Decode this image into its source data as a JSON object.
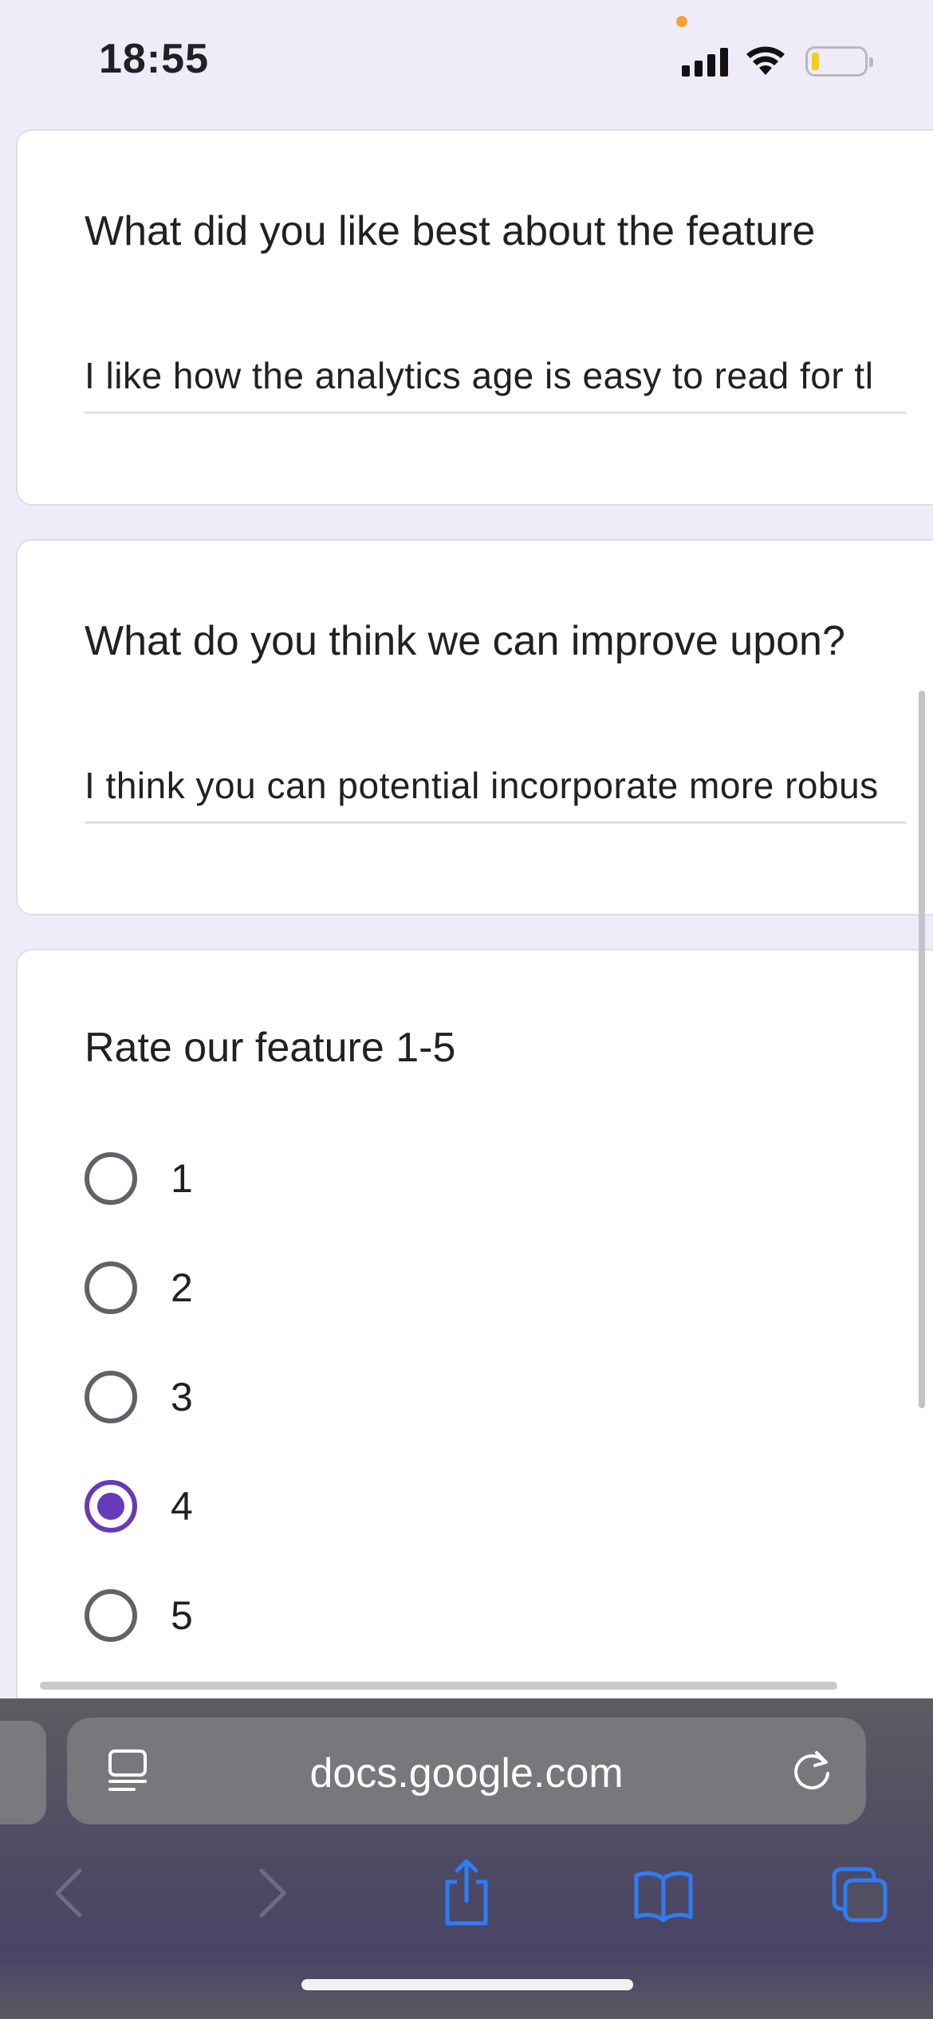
{
  "status_bar": {
    "time": "18:55",
    "icons": [
      "signal-icon",
      "wifi-icon",
      "battery-icon"
    ]
  },
  "form": {
    "questions": [
      {
        "title": "What did you like best about the feature",
        "answer": "I like how the analytics age is easy to read for tl"
      },
      {
        "title": "What do you think we can improve upon?",
        "answer": "I think you can potential incorporate more robus"
      }
    ],
    "rating": {
      "title": "Rate our feature 1-5",
      "options": [
        "1",
        "2",
        "3",
        "4",
        "5"
      ],
      "selected": "4",
      "accent_color": "#673ab7"
    }
  },
  "browser": {
    "url": "docs.google.com",
    "icons": [
      "reader-mode-icon",
      "reload-icon",
      "back-icon",
      "forward-icon",
      "share-icon",
      "bookmarks-icon",
      "tabs-icon"
    ]
  }
}
